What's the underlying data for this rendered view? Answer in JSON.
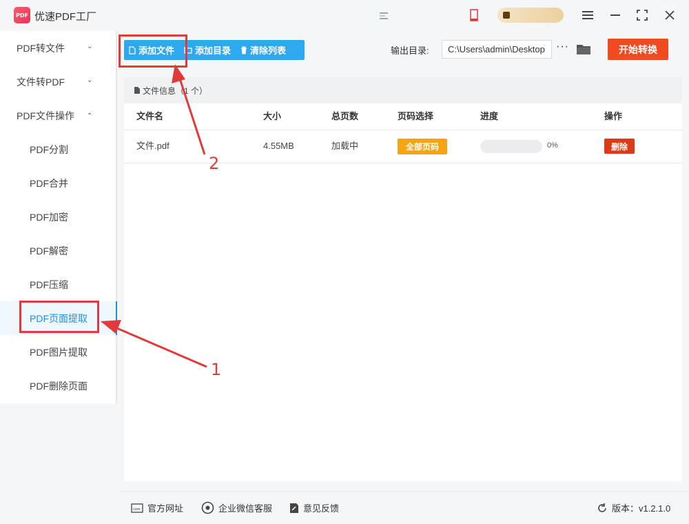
{
  "app": {
    "title": "优速PDF工厂",
    "logo_text": "PDF"
  },
  "window": {
    "menu_icon": "menu-icon",
    "minimize_icon": "minimize-icon",
    "maximize_icon": "maximize-icon",
    "close_icon": "close-icon"
  },
  "sidebar": {
    "groups": [
      {
        "label": "PDF转文件",
        "chevron": "chevron-down-icon"
      },
      {
        "label": "文件转PDF",
        "chevron": "chevron-down-icon"
      },
      {
        "label": "PDF文件操作",
        "chevron": "chevron-up-icon"
      }
    ],
    "items": [
      {
        "label": "PDF分割"
      },
      {
        "label": "PDF合并"
      },
      {
        "label": "PDF加密"
      },
      {
        "label": "PDF解密"
      },
      {
        "label": "PDF压缩"
      },
      {
        "label": "PDF页面提取",
        "active": true
      },
      {
        "label": "PDF图片提取"
      },
      {
        "label": "PDF删除页面"
      }
    ]
  },
  "toolbar": {
    "add_file": "添加文件",
    "add_dir": "添加目录",
    "clear_list": "清除列表",
    "output_label": "输出目录:",
    "output_path": "C:\\Users\\admin\\Desktop",
    "more": "···",
    "start": "开始转换"
  },
  "file_info": {
    "title": "文件信息",
    "count": "（1 个）"
  },
  "table": {
    "columns": [
      "文件名",
      "大小",
      "总页数",
      "页码选择",
      "进度",
      "操作"
    ],
    "rows": [
      {
        "name": "文件.pdf",
        "size": "4.55MB",
        "pages": "加载中",
        "page_select": "全部页码",
        "progress_text": "0%",
        "progress_value": 0,
        "action": "删除"
      }
    ]
  },
  "footer": {
    "website": "官方网址",
    "wechat": "企业微信客服",
    "feedback": "意见反馈",
    "version": "版本：v1.2.1.0"
  },
  "annotations": {
    "step1": "1",
    "step2": "2"
  },
  "colors": {
    "accent": "#2ea9f0",
    "start_button": "#ef4a20",
    "badge": "#f6a414",
    "delete": "#dd3a18",
    "annotation": "#e23a3a"
  }
}
